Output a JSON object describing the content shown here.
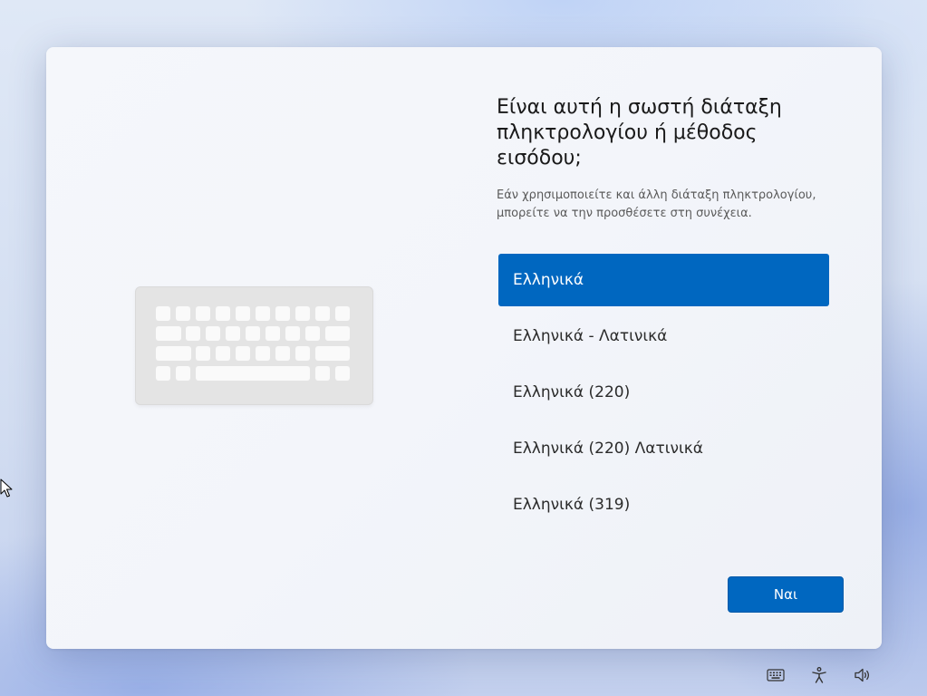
{
  "page": {
    "title": "Είναι αυτή η σωστή διάταξη πληκτρολογίου ή μέθοδος εισόδου;",
    "subtitle": "Εάν χρησιμοποιείτε και άλλη διάταξη πληκτρολογίου, μπορείτε να την προσθέσετε στη συνέχεια."
  },
  "layouts": [
    {
      "label": "Ελληνικά",
      "selected": true
    },
    {
      "label": "Ελληνικά - Λατινικά",
      "selected": false
    },
    {
      "label": "Ελληνικά (220)",
      "selected": false
    },
    {
      "label": "Ελληνικά (220) Λατινικά",
      "selected": false
    },
    {
      "label": "Ελληνικά (319)",
      "selected": false
    }
  ],
  "actions": {
    "yes_label": "Ναι"
  },
  "tray": {
    "icons": [
      "keyboard-icon",
      "accessibility-icon",
      "volume-icon"
    ]
  },
  "colors": {
    "accent": "#0067c0"
  }
}
